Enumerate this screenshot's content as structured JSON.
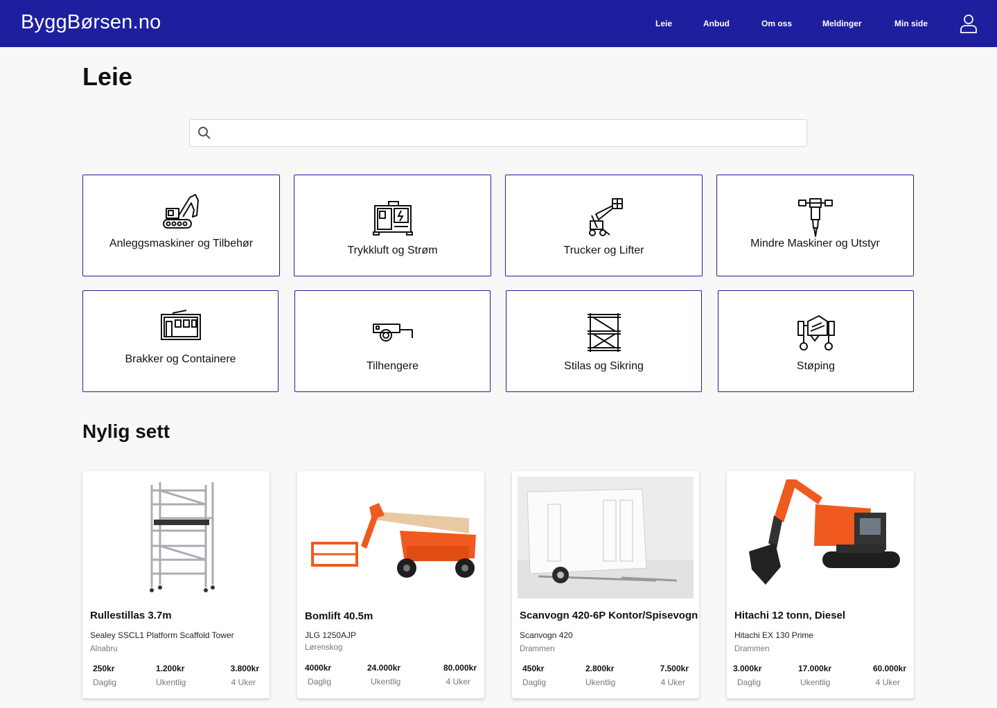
{
  "header": {
    "logo": "ByggBørsen.no",
    "nav": [
      "Leie",
      "Anbud",
      "Om oss",
      "Meldinger",
      "Min side"
    ],
    "user_icon": "user-icon"
  },
  "page": {
    "title": "Leie"
  },
  "search": {
    "value": "",
    "placeholder": "",
    "icon": "search-icon"
  },
  "categories": [
    {
      "label": "Anleggsmaskiner og Tilbehør",
      "icon": "excavator-icon"
    },
    {
      "label": "Trykkluft og Strøm",
      "icon": "generator-icon"
    },
    {
      "label": "Trucker og Lifter",
      "icon": "lift-icon"
    },
    {
      "label": "Mindre Maskiner og Utstyr",
      "icon": "jackhammer-icon"
    },
    {
      "label": "Brakker og Containere",
      "icon": "container-icon"
    },
    {
      "label": "Tilhengere",
      "icon": "trailer-icon"
    },
    {
      "label": "Stilas og Sikring",
      "icon": "scaffold-icon"
    },
    {
      "label": "Støping",
      "icon": "cement-mixer-icon"
    }
  ],
  "recent": {
    "title": "Nylig sett",
    "items": [
      {
        "title": "Rullestillas 3.7m",
        "model": "Sealey SSCL1 Platform Scaffold Tower",
        "location": "Alnabru",
        "prices": [
          {
            "value": "250kr",
            "label": "Daglig"
          },
          {
            "value": "1.200kr",
            "label": "Ukentlig"
          },
          {
            "value": "3.800kr",
            "label": "4 Uker"
          }
        ]
      },
      {
        "title": "Bomlift 40.5m",
        "model": "JLG 1250AJP",
        "location": "Lørenskog",
        "prices": [
          {
            "value": "4000kr",
            "label": "Daglig"
          },
          {
            "value": "24.000kr",
            "label": "Ukentlig"
          },
          {
            "value": "80.000kr",
            "label": "4 Uker"
          }
        ]
      },
      {
        "title": "Scanvogn 420-6P Kontor/Spisevogn",
        "model": "Scanvogn 420",
        "location": "Drammen",
        "prices": [
          {
            "value": "450kr",
            "label": "Daglig"
          },
          {
            "value": "2.800kr",
            "label": "Ukentlig"
          },
          {
            "value": "7.500kr",
            "label": "4 Uker"
          }
        ]
      },
      {
        "title": "Hitachi  12 tonn, Diesel",
        "model": "Hitachi EX 130 Prime",
        "location": "Drammen",
        "prices": [
          {
            "value": "3.000kr",
            "label": "Daglig"
          },
          {
            "value": "17.000kr",
            "label": "Ukentlig"
          },
          {
            "value": "60.000kr",
            "label": "4 Uker"
          }
        ]
      }
    ]
  },
  "colors": {
    "brand": "#1e1f9f",
    "background": "#f8f8f8",
    "accent_orange": "#f05a1e"
  }
}
